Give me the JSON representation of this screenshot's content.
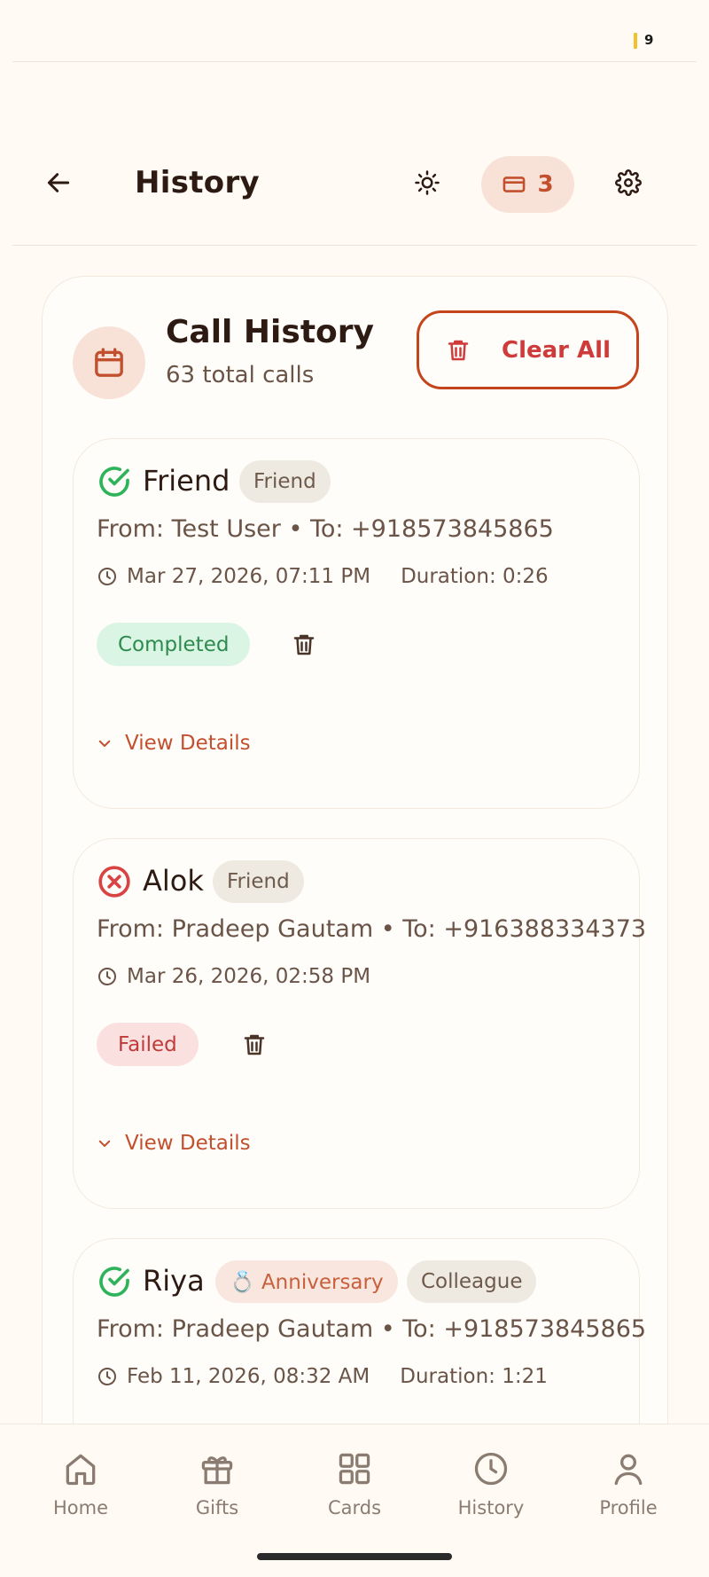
{
  "status_bar": {
    "battery_level": "9"
  },
  "header": {
    "title": "History",
    "credits_count": "3"
  },
  "history_panel": {
    "title": "Call History",
    "subtitle": "63 total calls",
    "clear_all_label": "Clear All"
  },
  "calls": [
    {
      "name": "Friend",
      "status_icon": "check-circle-icon",
      "tags": [
        "Friend"
      ],
      "route": "From: Test User • To: +918573845865",
      "datetime": "Mar 27, 2026, 07:11 PM",
      "duration": "Duration: 0:26",
      "status": "Completed",
      "view_details": "View Details"
    },
    {
      "name": "Alok",
      "status_icon": "x-circle-icon",
      "tags": [
        "Friend"
      ],
      "route": "From: Pradeep Gautam • To: +916388334373",
      "datetime": "Mar 26, 2026, 02:58 PM",
      "status": "Failed",
      "view_details": "View Details"
    },
    {
      "name": "Riya",
      "status_icon": "check-circle-icon",
      "tags": [
        "💍 Anniversary",
        "Colleague"
      ],
      "route": "From: Pradeep Gautam • To: +918573845865",
      "datetime": "Feb 11, 2026, 08:32 AM",
      "duration": "Duration: 1:21"
    }
  ],
  "bottom_nav": {
    "items": [
      {
        "label": "Home",
        "icon": "home-icon"
      },
      {
        "label": "Gifts",
        "icon": "gift-icon"
      },
      {
        "label": "Cards",
        "icon": "grid-icon"
      },
      {
        "label": "History",
        "icon": "clock-icon"
      },
      {
        "label": "Profile",
        "icon": "user-icon"
      }
    ]
  },
  "colors": {
    "background": "#fffbf4",
    "accent": "#c2502e",
    "success": "#2fb35a",
    "danger": "#d84343"
  }
}
